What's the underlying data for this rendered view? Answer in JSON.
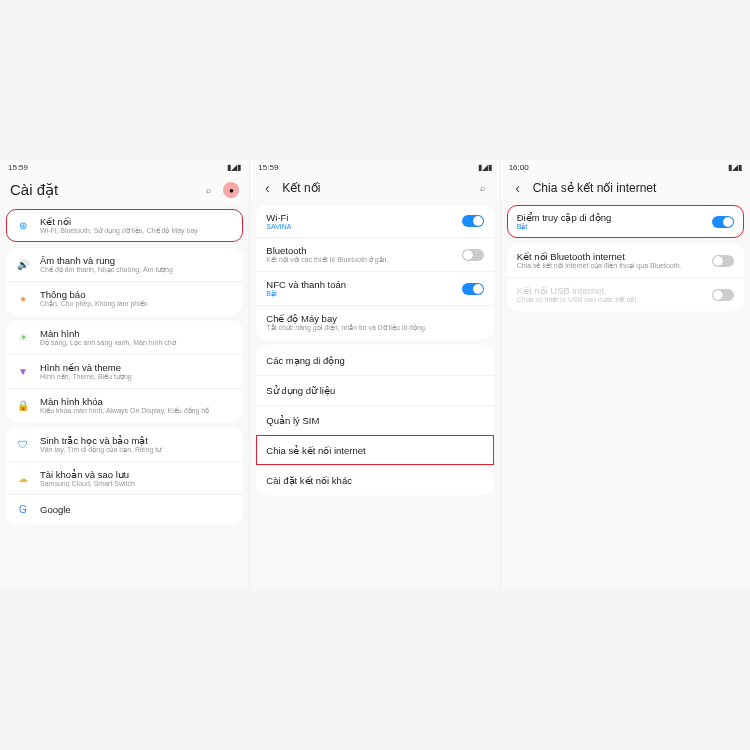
{
  "p1": {
    "time": "15:59",
    "title": "Cài đặt",
    "items": [
      {
        "icon": "wifi",
        "title": "Kết nối",
        "sub": "Wi-Fi, Bluetooth, Sử dụng dữ liệu, Chế độ Máy bay"
      },
      {
        "icon": "sound",
        "title": "Âm thanh và rung",
        "sub": "Chế độ âm thanh, Nhạc chuông, Âm lượng"
      },
      {
        "icon": "notif",
        "title": "Thông báo",
        "sub": "Chặn, Cho phép, Không làm phiền"
      },
      {
        "icon": "disp",
        "title": "Màn hình",
        "sub": "Độ sáng, Lọc ánh sáng xanh, Màn hình chờ"
      },
      {
        "icon": "theme",
        "title": "Hình nền và theme",
        "sub": "Hình nền, Theme, Biểu tượng"
      },
      {
        "icon": "lock",
        "title": "Màn hình khóa",
        "sub": "Kiểu khóa màn hình, Always On Display, Kiểu đồng hồ"
      },
      {
        "icon": "bio",
        "title": "Sinh trắc học và bảo mật",
        "sub": "Vân tay, Tìm di động của bạn, Riêng tư"
      },
      {
        "icon": "acct",
        "title": "Tài khoản và sao lưu",
        "sub": "Samsung Cloud, Smart Switch"
      },
      {
        "icon": "goog",
        "title": "Google",
        "sub": ""
      }
    ]
  },
  "p2": {
    "time": "15:59",
    "title": "Kết nối",
    "g1": [
      {
        "title": "Wi-Fi",
        "sub": "SAVINA",
        "accent": true,
        "toggle": "on"
      },
      {
        "title": "Bluetooth",
        "sub": "Kết nối với các thiết bị Bluetooth ở gần.",
        "toggle": "off"
      },
      {
        "title": "NFC và thanh toán",
        "sub": "Bật",
        "accent": true,
        "toggle": "on"
      },
      {
        "title": "Chế độ Máy bay",
        "sub": "Tắt chức năng gọi điện, nhắn tin và Dữ liệu di động."
      }
    ],
    "g2": [
      {
        "title": "Các mạng di động"
      },
      {
        "title": "Sử dụng dữ liệu"
      },
      {
        "title": "Quản lý SIM"
      },
      {
        "title": "Chia sẻ kết nối internet"
      },
      {
        "title": "Cài đặt kết nối khác"
      }
    ]
  },
  "p3": {
    "time": "16:00",
    "title": "Chia sẻ kết nối internet",
    "items": [
      {
        "title": "Điểm truy cập di động",
        "sub": "Bật",
        "accent": true,
        "toggle": "on"
      },
      {
        "title": "Kết nối Bluetooth internet",
        "sub": "Chia sẻ kết nối internet của điện thoại qua Bluetooth.",
        "toggle": "off"
      },
      {
        "title": "Kết nối USB internet",
        "sub": "Chưa có thiết bị USB nào được kết nối.",
        "toggle": "off",
        "disabled": true
      }
    ]
  },
  "glyphs": {
    "wifi": "⊛",
    "sound": "🔊",
    "notif": "●",
    "disp": "☀",
    "theme": "▼",
    "lock": "🔒",
    "bio": "🛡",
    "acct": "☁",
    "goog": "G",
    "search": "⌕",
    "back": "‹",
    "signal": "▮◢▮"
  }
}
